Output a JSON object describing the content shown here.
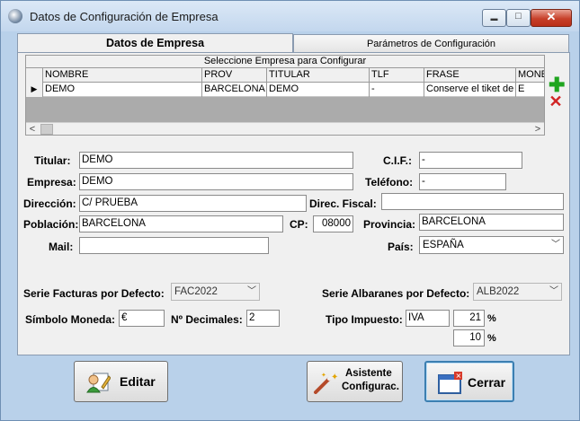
{
  "window": {
    "title": "Datos de Configuración de Empresa",
    "icon": "gear-app-icon"
  },
  "titlebar_buttons": {
    "minimize": "▬",
    "maximize": "□",
    "close": "✕"
  },
  "tabs": [
    {
      "label": "Datos de Empresa",
      "active": true
    },
    {
      "label": "Parámetros de Configuración",
      "active": false
    }
  ],
  "grid": {
    "caption": "Seleccione Empresa para Configurar",
    "columns": [
      "NOMBRE",
      "PROV",
      "TITULAR",
      "TLF",
      "FRASE",
      "MONE"
    ],
    "rows": [
      [
        "DEMO",
        "BARCELONA",
        "DEMO",
        "-",
        "Conserve el tiket de",
        "E"
      ]
    ],
    "row_indicator": "▶",
    "scroll_left": "<",
    "scroll_right": ">"
  },
  "side_actions": {
    "add": "✚",
    "delete": "✕"
  },
  "form": {
    "titular": {
      "label": "Titular:",
      "value": "DEMO"
    },
    "cif": {
      "label": "C.I.F.:",
      "value": "-"
    },
    "empresa": {
      "label": "Empresa:",
      "value": "DEMO"
    },
    "telefono": {
      "label": "Teléfono:",
      "value": "-"
    },
    "direccion": {
      "label": "Dirección:",
      "value": "C/ PRUEBA"
    },
    "direc_fiscal": {
      "label": "Direc. Fiscal:",
      "value": ""
    },
    "poblacion": {
      "label": "Población:",
      "value": "BARCELONA"
    },
    "cp": {
      "label": "CP:",
      "value": "08000"
    },
    "provincia": {
      "label": "Provincia:",
      "value": "BARCELONA"
    },
    "mail": {
      "label": "Mail:",
      "value": ""
    },
    "pais": {
      "label": "País:",
      "value": "ESPAÑA"
    },
    "serie_facturas": {
      "label": "Serie Facturas por Defecto:",
      "value": "FAC2022"
    },
    "serie_albaranes": {
      "label": "Serie Albaranes por Defecto:",
      "value": "ALB2022"
    },
    "simbolo_moneda": {
      "label": "Símbolo Moneda:",
      "value": "€"
    },
    "decimales": {
      "label": "Nº Decimales:",
      "value": "2"
    },
    "tipo_impuesto": {
      "label": "Tipo Impuesto:",
      "value": "IVA",
      "rate1": "21",
      "rate2": "10",
      "pct": "%"
    }
  },
  "buttons": {
    "editar": {
      "label": "Editar",
      "icon": "edit-user-icon"
    },
    "asistente": {
      "line1": "Asistente",
      "line2": "Configurac.",
      "icon": "wizard-wand-icon"
    },
    "cerrar": {
      "label": "Cerrar",
      "icon": "close-window-icon"
    }
  }
}
